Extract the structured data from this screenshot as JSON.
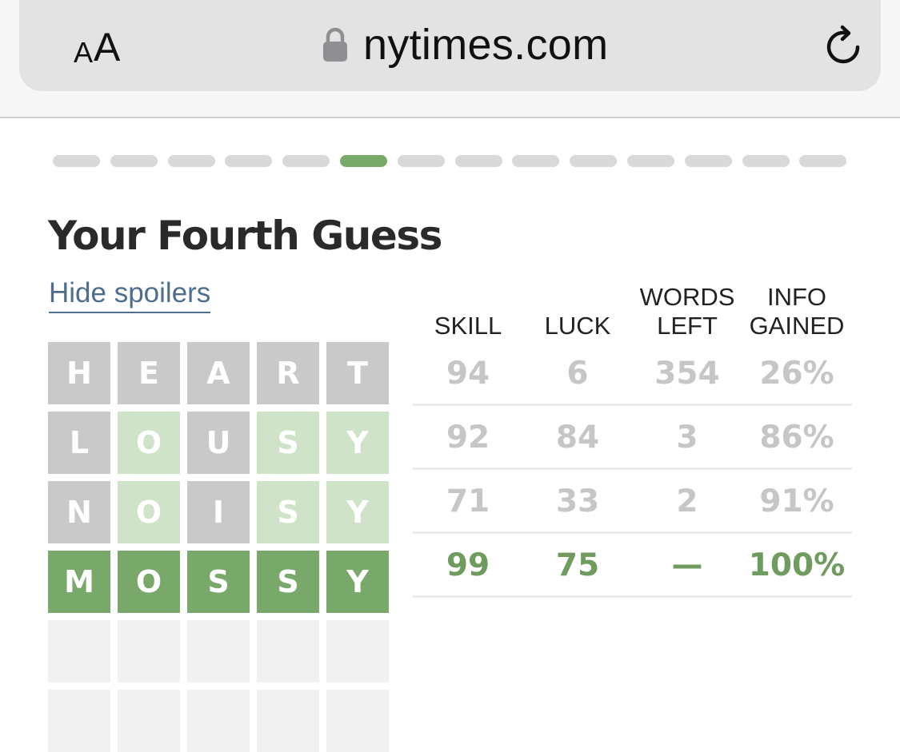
{
  "browser": {
    "text_size_small": "A",
    "text_size_large": "A",
    "url": "nytimes.com"
  },
  "progress": {
    "total_steps": 14,
    "current_step": 6,
    "colors": {
      "inactive": "#d9d9d9",
      "active": "#79a86b"
    }
  },
  "page": {
    "title": "Your Fourth Guess",
    "hide_spoilers_label": "Hide spoilers"
  },
  "grid": {
    "rows": [
      {
        "letters": [
          "H",
          "E",
          "A",
          "R",
          "T"
        ],
        "states": [
          "gray",
          "gray",
          "gray",
          "gray",
          "gray"
        ]
      },
      {
        "letters": [
          "L",
          "O",
          "U",
          "S",
          "Y"
        ],
        "states": [
          "gray",
          "lgreen",
          "gray",
          "lgreen",
          "lgreen"
        ]
      },
      {
        "letters": [
          "N",
          "O",
          "I",
          "S",
          "Y"
        ],
        "states": [
          "gray",
          "lgreen",
          "gray",
          "lgreen",
          "lgreen"
        ]
      },
      {
        "letters": [
          "M",
          "O",
          "S",
          "S",
          "Y"
        ],
        "states": [
          "green",
          "green",
          "green",
          "green",
          "green"
        ]
      },
      {
        "letters": [
          "",
          "",
          "",
          "",
          ""
        ],
        "states": [
          "empty",
          "empty",
          "empty",
          "empty",
          "empty"
        ]
      },
      {
        "letters": [
          "",
          "",
          "",
          "",
          ""
        ],
        "states": [
          "empty",
          "empty",
          "empty",
          "empty",
          "empty"
        ]
      }
    ],
    "colors": {
      "gray": "#c9c9c9",
      "light_green": "#cfe3c8",
      "green": "#79a86b",
      "empty": "#f1f1f1"
    }
  },
  "stats": {
    "headers": [
      {
        "line1": "",
        "line2": "SKILL"
      },
      {
        "line1": "",
        "line2": "LUCK"
      },
      {
        "line1": "WORDS",
        "line2": "LEFT"
      },
      {
        "line1": "INFO",
        "line2": "GAINED"
      }
    ],
    "rows": [
      [
        "94",
        "6",
        "354",
        "26%"
      ],
      [
        "92",
        "84",
        "3",
        "86%"
      ],
      [
        "71",
        "33",
        "2",
        "91%"
      ],
      [
        "99",
        "75",
        "—",
        "100%"
      ]
    ]
  }
}
